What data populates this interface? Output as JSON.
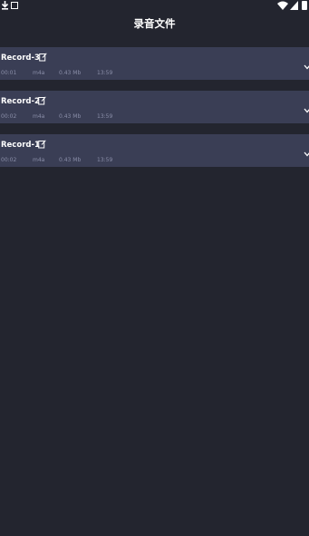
{
  "status_bar": {
    "icons": [
      "download-icon",
      "notification-box-icon",
      "wifi-icon",
      "signal-icon",
      "battery-icon"
    ]
  },
  "header": {
    "title": "录音文件"
  },
  "recordings": [
    {
      "name": "Record-3",
      "duration": "00:01",
      "format": "m4a",
      "size": "0.43 Mb",
      "time": "13:59"
    },
    {
      "name": "Record-2",
      "duration": "00:02",
      "format": "m4a",
      "size": "0.43 Mb",
      "time": "13:59"
    },
    {
      "name": "Record-1",
      "duration": "00:02",
      "format": "m4a",
      "size": "0.43 Mb",
      "time": "13:59"
    }
  ],
  "colors": {
    "background": "#23252f",
    "row": "#3a3e55",
    "meta_text": "#8a8ea8"
  }
}
